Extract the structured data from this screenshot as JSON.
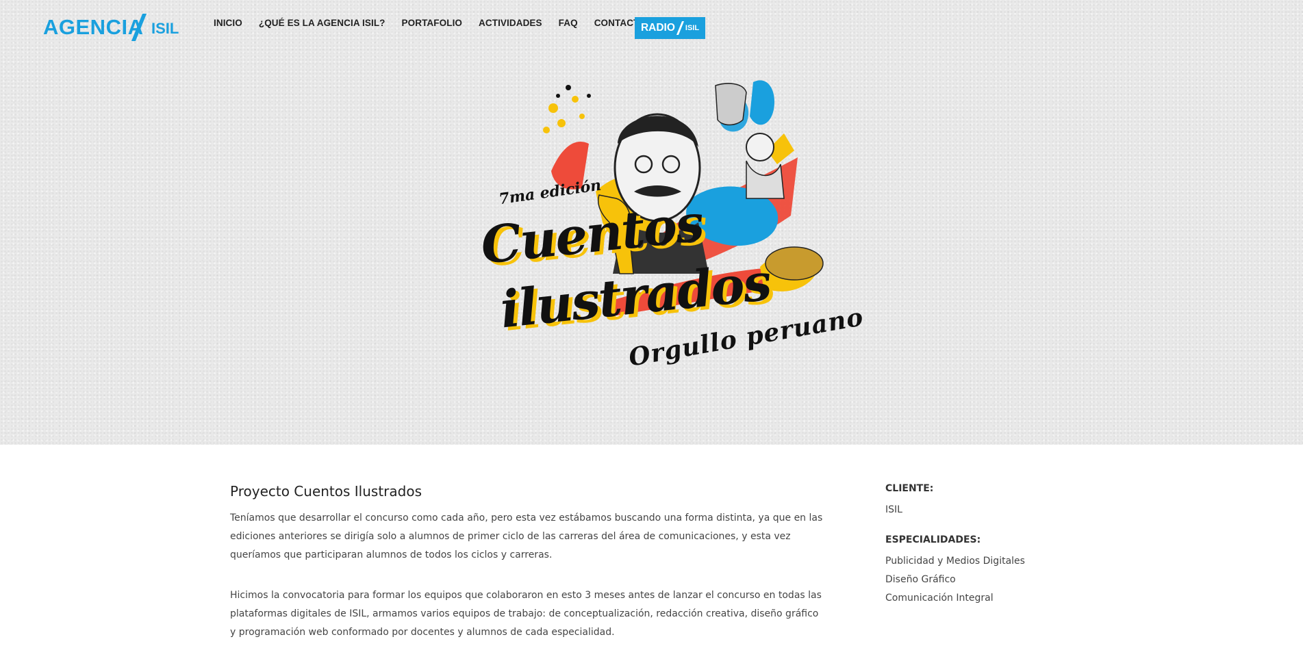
{
  "header": {
    "logo_text": "AGENCIA",
    "logo_sub": "ISIL",
    "nav": [
      {
        "label": "INICIO"
      },
      {
        "label": "¿QUÉ ES LA AGENCIA ISIL?"
      },
      {
        "label": "PORTAFOLIO"
      },
      {
        "label": "ACTIVIDADES"
      },
      {
        "label": "FAQ"
      },
      {
        "label": "CONTACTO"
      }
    ],
    "radio": {
      "main": "RADIO",
      "sub": "ISIL"
    }
  },
  "hero": {
    "edicion": "7ma edición",
    "title_line1": "Cuentos",
    "title_line2": "ilustrados",
    "tagline": "Orgullo peruano"
  },
  "project": {
    "title": "Proyecto Cuentos Ilustrados",
    "paragraphs": [
      "Teníamos que desarrollar el concurso como cada año, pero esta vez estábamos buscando una forma distinta, ya que en las ediciones anteriores se dirigía solo a alumnos de primer ciclo de las carreras del área de comunicaciones, y esta vez queríamos que participaran alumnos de todos los ciclos y carreras.",
      "Hicimos la convocatoria para formar los equipos que colaboraron en esto 3 meses antes de lanzar el concurso en todas las plataformas digitales de ISIL, armamos varios equipos de trabajo: de conceptualización, redacción creativa, diseño gráfico y programación web conformado por docentes y alumnos de cada especialidad."
    ]
  },
  "sidebar": {
    "client_label": "CLIENTE:",
    "client_value": "ISIL",
    "specialties_label": "ESPECIALIDADES:",
    "specialties": [
      "Publicidad y Medios Digitales",
      "Diseño Gráfico",
      "Comunicación Integral"
    ]
  },
  "colors": {
    "brand_blue": "#1aa0de",
    "accent_yellow": "#f7c20a",
    "accent_red": "#ee4b3a"
  }
}
